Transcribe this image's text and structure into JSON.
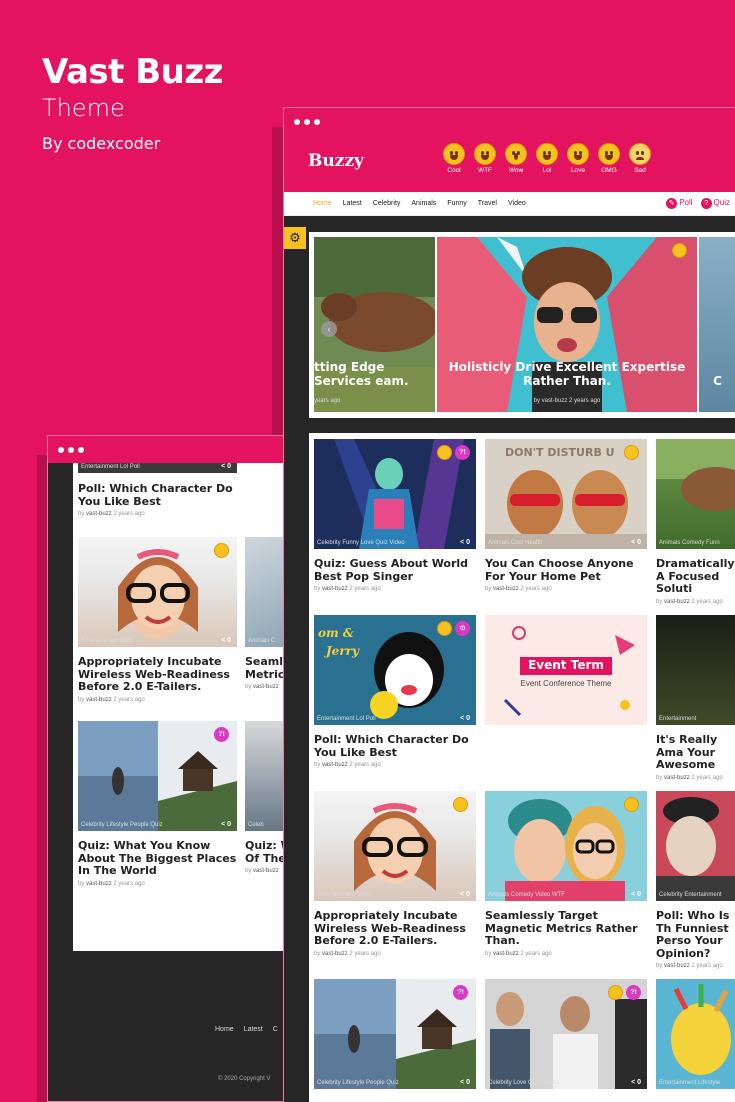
{
  "hero": {
    "title": "Vast Buzz",
    "subtitle": "Theme",
    "author": "By codexcoder"
  },
  "colors": {
    "brand": "#e4135f",
    "dark": "#262626",
    "accent": "#f3a71c",
    "quiz": "#d83ac6"
  },
  "back_window": {
    "cards": [
      {
        "tags": "Entertainment  Lol  Poll",
        "share": "< 0",
        "title": "Poll: Which Character Do You Like Best",
        "author": "vast-buzz",
        "time": "2 years ago"
      },
      {
        "tags": "Entertainment  OMG",
        "share": "< 0",
        "title": "Appropriately Incubate Wireless Web-Readiness Before 2.0 E-Tailers.",
        "author": "vast-buzz",
        "time": "2 years ago"
      },
      {
        "tags": "Celebrity  Lifestyle  People  Quiz",
        "share": "< 0",
        "title": "Quiz: What You Know About The Biggest Places In The World",
        "author": "vast-buzz",
        "time": "2 years ago"
      },
      {
        "tags": "Animals  C",
        "title": "Seamle Metrics",
        "author": "vast-buzz"
      },
      {
        "tags": "Celeb",
        "title": "Quiz: W Of The",
        "author": "vast-buzz"
      }
    ],
    "footer_nav": [
      "Home",
      "Latest",
      "C"
    ],
    "copyright": "© 2020 Copyright V"
  },
  "front_window": {
    "logo": "Buzzy",
    "reactions": [
      {
        "label": "Cool"
      },
      {
        "label": "WTF"
      },
      {
        "label": "Wow"
      },
      {
        "label": "Lol"
      },
      {
        "label": "Love"
      },
      {
        "label": "OMG"
      },
      {
        "label": "Sad"
      }
    ],
    "nav": [
      "Home",
      "Latest",
      "Celebrity",
      "Animals",
      "Funny",
      "Travel",
      "Video"
    ],
    "nav_right": {
      "poll": "Poll",
      "quiz": "Quiz"
    },
    "slides": [
      {
        "caption": "tting Edge Services eam.",
        "meta": "years ago"
      },
      {
        "caption": "Holisticly Drive Excellent Expertise Rather Than.",
        "author": "vast-buzz",
        "time": "2 years ago"
      },
      {
        "caption": "C"
      }
    ],
    "cards": [
      {
        "tags": "Celebrity  Funny  Love  Quiz  Video",
        "share": "< 0",
        "title": "Quiz: Guess About World Best Pop Singer",
        "author": "vast-buzz",
        "time": "2 years ago"
      },
      {
        "tags": "Animals  Cool  Health",
        "share": "< 0",
        "title": "You Can Choose Anyone For Your Home Pet",
        "author": "vast-buzz",
        "time": "2 years ago"
      },
      {
        "tags": "Animals  Comedy  Funn",
        "title": "Dramatically A Focused Soluti",
        "author": "vast-buzz",
        "time": "2 years ago"
      },
      {
        "tags": "Entertainment  Lol  Poll",
        "share": "< 0",
        "title": "Poll: Which Character Do You Like Best",
        "author": "vast-buzz",
        "time": "2 years ago"
      },
      {
        "ad_title": "Event Term",
        "ad_sub": "Event Conference Theme"
      },
      {
        "tags": "Entertainment",
        "title": "It's Really Ama Your Awesome",
        "author": "vast-buzz",
        "time": "2 years ago"
      },
      {
        "tags": "Entertainment  OMG",
        "share": "< 0",
        "title": "Appropriately Incubate Wireless Web-Readiness Before 2.0 E-Tailers.",
        "author": "vast-buzz",
        "time": "2 years ago"
      },
      {
        "tags": "Animals  Comedy  Video  WTF",
        "share": "< 0",
        "title": "Seamlessly Target Magnetic Metrics Rather Than.",
        "author": "vast-buzz",
        "time": "2 years ago"
      },
      {
        "tags": "Celebrity  Entertainment",
        "title": "Poll: Who Is Th Funniest Perso Your Opinion?",
        "author": "vast-buzz",
        "time": "2 years ago"
      },
      {
        "tags": "Celebrity  Lifestyle  People  Quiz",
        "share": "< 0"
      },
      {
        "tags": "Celebrity  Love  Quiz  Sports",
        "share": "< 0"
      },
      {
        "tags": "Entertainment  Lifestyle"
      }
    ]
  }
}
